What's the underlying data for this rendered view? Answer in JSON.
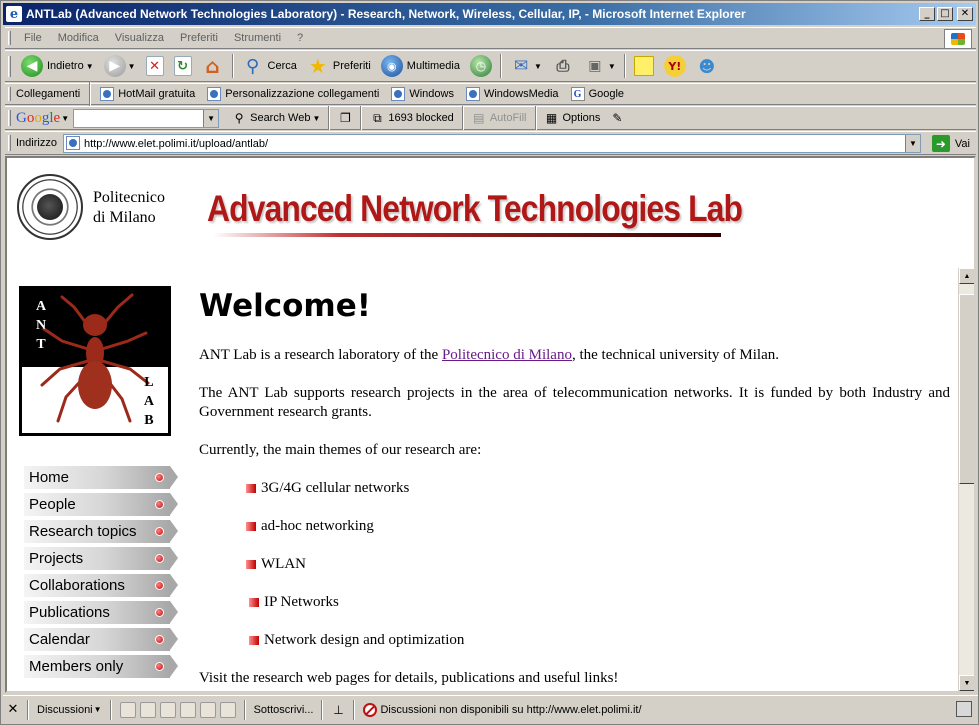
{
  "window": {
    "title": "ANTLab (Advanced Network Technologies Laboratory) - Research, Network, Wireless, Cellular, IP,  - Microsoft Internet Explorer",
    "app_icon": "e",
    "controls": [
      "_",
      "□",
      "✕"
    ]
  },
  "menu": [
    "File",
    "Modifica",
    "Visualizza",
    "Preferiti",
    "Strumenti",
    "?"
  ],
  "toolbar": {
    "back_label": "Indietro",
    "search_label": "Cerca",
    "favorites_label": "Preferiti",
    "media_label": "Multimedia"
  },
  "links": {
    "label": "Collegamenti",
    "items": [
      "HotMail gratuita",
      "Personalizzazione collegamenti",
      "Windows",
      "WindowsMedia",
      "Google"
    ]
  },
  "google_bar": {
    "logo": [
      "G",
      "o",
      "o",
      "g",
      "l",
      "e"
    ],
    "search_web": "Search Web",
    "blocked": "1693 blocked",
    "autofill": "AutoFill",
    "options": "Options"
  },
  "address": {
    "label": "Indirizzo",
    "url": "http://www.elet.polimi.it/upload/antlab/",
    "go_label": "Vai"
  },
  "page": {
    "institution_line1": "Politecnico",
    "institution_line2": "di Milano",
    "banner": "Advanced Network Technologies Lab",
    "logo_letters_top": [
      "A",
      "N",
      "T"
    ],
    "logo_letters_bottom": [
      "L",
      "A",
      "B"
    ],
    "nav": [
      "Home",
      "People",
      "Research topics",
      "Projects",
      "Collaborations",
      "Publications",
      "Calendar",
      "Members only"
    ],
    "welcome": "Welcome!",
    "intro_before": "ANT Lab is a research laboratory of the ",
    "intro_link": "Politecnico di Milano",
    "intro_after": ", the technical university of Milan.",
    "support": "The ANT Lab supports research projects in the area of telecommunication networks. It is funded by both Industry and Government research grants.",
    "themes_intro": "Currently, the main themes of our research are:",
    "themes": [
      "3G/4G cellular networks",
      "ad-hoc networking",
      "WLAN",
      "IP Networks",
      "Network design and optimization"
    ],
    "visit": "Visit the research web pages for details, publications and useful links!"
  },
  "discussion_bar": {
    "close": "✕",
    "discussions": "Discussioni",
    "subscribe": "Sottoscrivi...",
    "status": "Discussioni non disponibili su http://www.elet.polimi.it/"
  },
  "colors": {
    "banner_red": "#b01818",
    "link_purple": "#6a1a8a",
    "titlebar_blue": "#0a246a"
  }
}
